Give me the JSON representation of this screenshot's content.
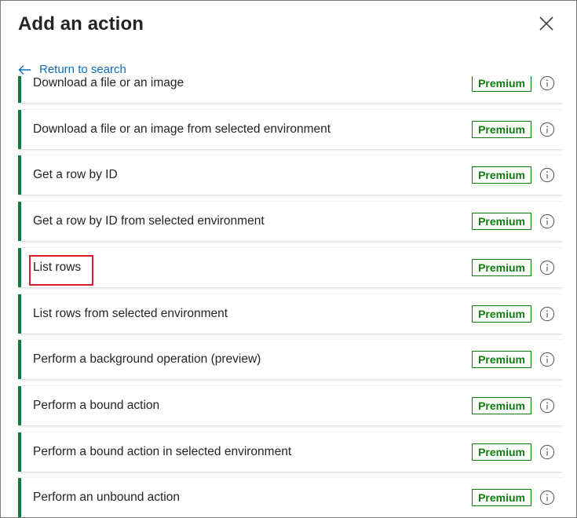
{
  "dialog": {
    "title": "Add an action",
    "back_link": "Return to search"
  },
  "actions": [
    {
      "label": "Download a file or an image",
      "badge": "Premium"
    },
    {
      "label": "Download a file or an image from selected environment",
      "badge": "Premium"
    },
    {
      "label": "Get a row by ID",
      "badge": "Premium"
    },
    {
      "label": "Get a row by ID from selected environment",
      "badge": "Premium"
    },
    {
      "label": "List rows",
      "badge": "Premium",
      "highlighted": true
    },
    {
      "label": "List rows from selected environment",
      "badge": "Premium"
    },
    {
      "label": "Perform a background operation (preview)",
      "badge": "Premium"
    },
    {
      "label": "Perform a bound action",
      "badge": "Premium"
    },
    {
      "label": "Perform a bound action in selected environment",
      "badge": "Premium"
    },
    {
      "label": "Perform an unbound action",
      "badge": "Premium"
    }
  ],
  "icons": {
    "close": "close-icon",
    "back": "arrow-left-icon",
    "info": "info-icon"
  },
  "colors": {
    "accent_bar": "#0e7a3b",
    "premium": "#107c10",
    "link": "#0f6cbd",
    "highlight": "#d81b25"
  }
}
